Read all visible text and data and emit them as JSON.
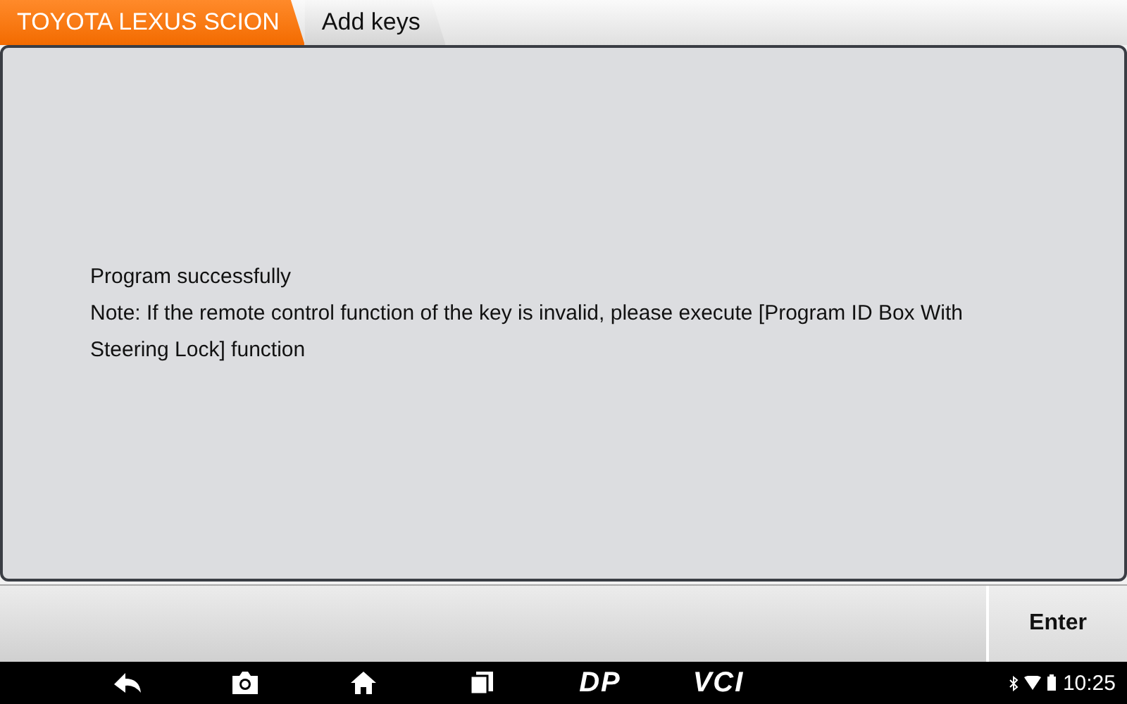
{
  "breadcrumbs": [
    {
      "label": "TOYOTA LEXUS SCION",
      "highlighted": true
    },
    {
      "label": "Add keys",
      "highlighted": false
    }
  ],
  "message": [
    "Program successfully",
    "Note: If the remote control function of the key is invalid,  please execute [Program ID Box With Steering Lock] function"
  ],
  "buttons": [
    "Enter"
  ],
  "nav_bar": {
    "logo_1": "DP",
    "logo_2": "VCI",
    "time": "10:25"
  }
}
